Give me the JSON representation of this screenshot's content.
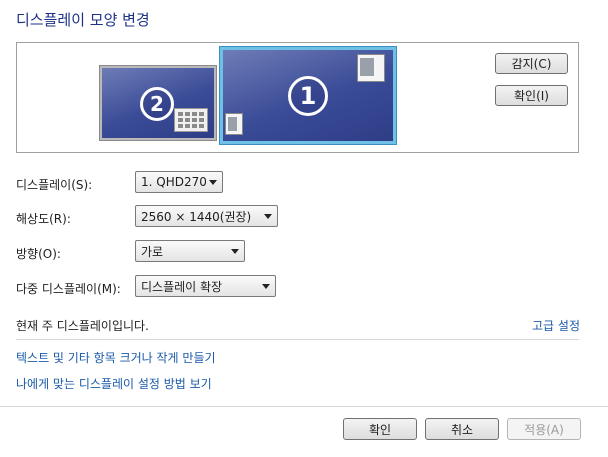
{
  "title": "디스플레이 모양 변경",
  "preview": {
    "monitor_1_number": "1",
    "monitor_2_number": "2"
  },
  "buttons": {
    "detect": "감지(C)",
    "identify": "확인(I)",
    "ok": "확인",
    "cancel": "취소",
    "apply": "적용(A)"
  },
  "fields": {
    "display": {
      "label": "디스플레이(S):",
      "value": "1. QHD270"
    },
    "resolution": {
      "label": "해상도(R):",
      "value": "2560 × 1440(권장)"
    },
    "orientation": {
      "label": "방향(O):",
      "value": "가로"
    },
    "multiple_displays": {
      "label": "다중 디스플레이(M):",
      "value": "디스플레이 확장"
    }
  },
  "status_text": "현재 주 디스플레이입니다.",
  "links": {
    "advanced": "고급 설정",
    "text_size": "텍스트 및 기타 항목 크거나 작게 만들기",
    "which_settings": "나에게 맞는 디스플레이 설정 방법 보기"
  },
  "colors": {
    "title": "#1e3287",
    "link": "#1a5aa8",
    "monitor_fill": "#3a4b97",
    "selected_border": "#6fc0e6"
  }
}
